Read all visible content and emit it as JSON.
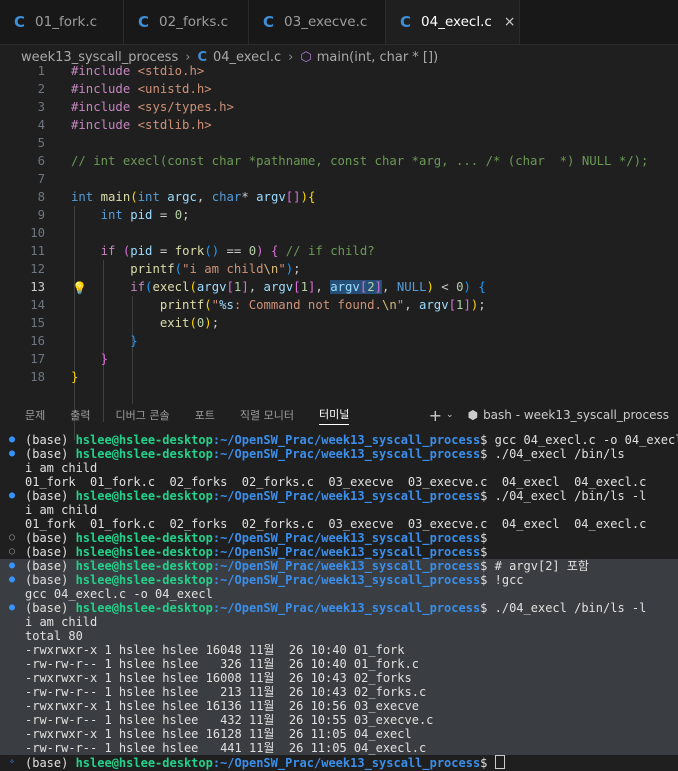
{
  "tabs": [
    {
      "label": "01_fork.c",
      "icon": "c-file-icon"
    },
    {
      "label": "02_forks.c",
      "icon": "c-file-icon"
    },
    {
      "label": "03_execve.c",
      "icon": "c-file-icon"
    },
    {
      "label": "04_execl.c",
      "icon": "c-file-icon",
      "active": true,
      "close": "×"
    }
  ],
  "breadcrumb": {
    "folder": "week13_syscall_process",
    "file": "04_execl.c",
    "symbol": "main(int, char * [])"
  },
  "code_lines": [
    "1",
    "2",
    "3",
    "4",
    "5",
    "6",
    "7",
    "8",
    "9",
    "10",
    "11",
    "12",
    "13",
    "14",
    "15",
    "16",
    "17",
    "18"
  ],
  "code": {
    "l1": [
      "#include",
      " <stdio.h>"
    ],
    "l2": [
      "#include",
      " <unistd.h>"
    ],
    "l3": [
      "#include",
      " <sys/types.h>"
    ],
    "l4": [
      "#include",
      " <stdlib.h>"
    ],
    "l6": "// int execl(const char *pathname, const char *arg, ... /* (char  *) NULL */);",
    "l8": {
      "t1": "int",
      "fn": "main",
      "t2": "int",
      "a1": "argc",
      "t3": "char",
      "a2": "argv"
    },
    "l9": {
      "t": "int",
      "v": "pid",
      "n": "0"
    },
    "l11": {
      "kw": "if",
      "v": "pid",
      "fn": "fork",
      "n": "0",
      "cm": "// if child?"
    },
    "l12": {
      "fn": "printf",
      "s": "\"i am child",
      "e": "\\n",
      "s2": "\""
    },
    "l13": {
      "kw": "if",
      "fn": "execl",
      "v1": "argv",
      "n1": "1",
      "v2": "argv",
      "n2": "1",
      "v3": "argv",
      "n3": "2",
      "nul": "NULL",
      "n4": "0"
    },
    "l14": {
      "fn": "printf",
      "s1": "\"",
      "e1": "%s",
      "s2": ": Command not found.",
      "e2": "\\n",
      "s3": "\"",
      "v": "argv",
      "n": "1"
    },
    "l15": {
      "fn": "exit",
      "n": "0"
    }
  },
  "panel": {
    "tabs": [
      "문제",
      "출력",
      "디버그 콘솔",
      "포트",
      "직렬 모니터",
      "터미널"
    ],
    "active_tab": "터미널",
    "plus": "+",
    "chevron": "⌄",
    "shell_label": "bash - week13_syscall_process"
  },
  "terminal": {
    "user": "hslee@hslee-desktop",
    "path": ":~/OpenSW_Prac/week13_syscall_process",
    "lines": [
      {
        "m": "blue",
        "base": "(base) ",
        "cmd": "$ gcc 04_execl.c -o 04_execl"
      },
      {
        "m": "blue",
        "base": "(base) ",
        "cmd": "$ ./04_execl /bin/ls"
      },
      {
        "text": "i am child"
      },
      {
        "text": "01_fork  01_fork.c  02_forks  02_forks.c  03_execve  03_execve.c  04_execl  04_execl.c"
      },
      {
        "m": "blue",
        "base": "(base) ",
        "cmd": "$ ./04_execl /bin/ls -l"
      },
      {
        "text": "i am child"
      },
      {
        "text": "01_fork  01_fork.c  02_forks  02_forks.c  03_execve  03_execve.c  04_execl  04_execl.c"
      },
      {
        "m": "hollow",
        "base": "(base) ",
        "cmd": "$"
      },
      {
        "m": "hollow",
        "base": "(base) ",
        "cmd": "$"
      },
      {
        "m": "blue",
        "base": "(base) ",
        "cmd": "$ # argv[2] 포함",
        "sel": true
      },
      {
        "m": "blue",
        "base": "(base) ",
        "cmd": "$ !gcc",
        "sel": true
      },
      {
        "text": "gcc 04_execl.c -o 04_execl",
        "sel": true
      },
      {
        "m": "blue",
        "base": "(base) ",
        "cmd": "$ ./04_execl /bin/ls -l",
        "sel": true
      },
      {
        "text": "i am child",
        "sel": true
      },
      {
        "text": "total 80",
        "sel": true
      },
      {
        "text": "-rwxrwxr-x 1 hslee hslee 16048 11월  26 10:40 01_fork",
        "sel": true
      },
      {
        "text": "-rw-rw-r-- 1 hslee hslee   326 11월  26 10:40 01_fork.c",
        "sel": true
      },
      {
        "text": "-rwxrwxr-x 1 hslee hslee 16008 11월  26 10:43 02_forks",
        "sel": true
      },
      {
        "text": "-rw-rw-r-- 1 hslee hslee   213 11월  26 10:43 02_forks.c",
        "sel": true
      },
      {
        "text": "-rwxrwxr-x 1 hslee hslee 16136 11월  26 10:56 03_execve",
        "sel": true
      },
      {
        "text": "-rw-rw-r-- 1 hslee hslee   432 11월  26 10:55 03_execve.c",
        "sel": true
      },
      {
        "text": "-rwxrwxr-x 1 hslee hslee 16128 11월  26 11:05 04_execl",
        "sel": true
      },
      {
        "text": "-rw-rw-r-- 1 hslee hslee   441 11월  26 11:05 04_execl.c",
        "sel": true
      },
      {
        "m": "sparkle",
        "base": "(base) ",
        "cmd": "$ ",
        "cursor": true
      }
    ]
  }
}
